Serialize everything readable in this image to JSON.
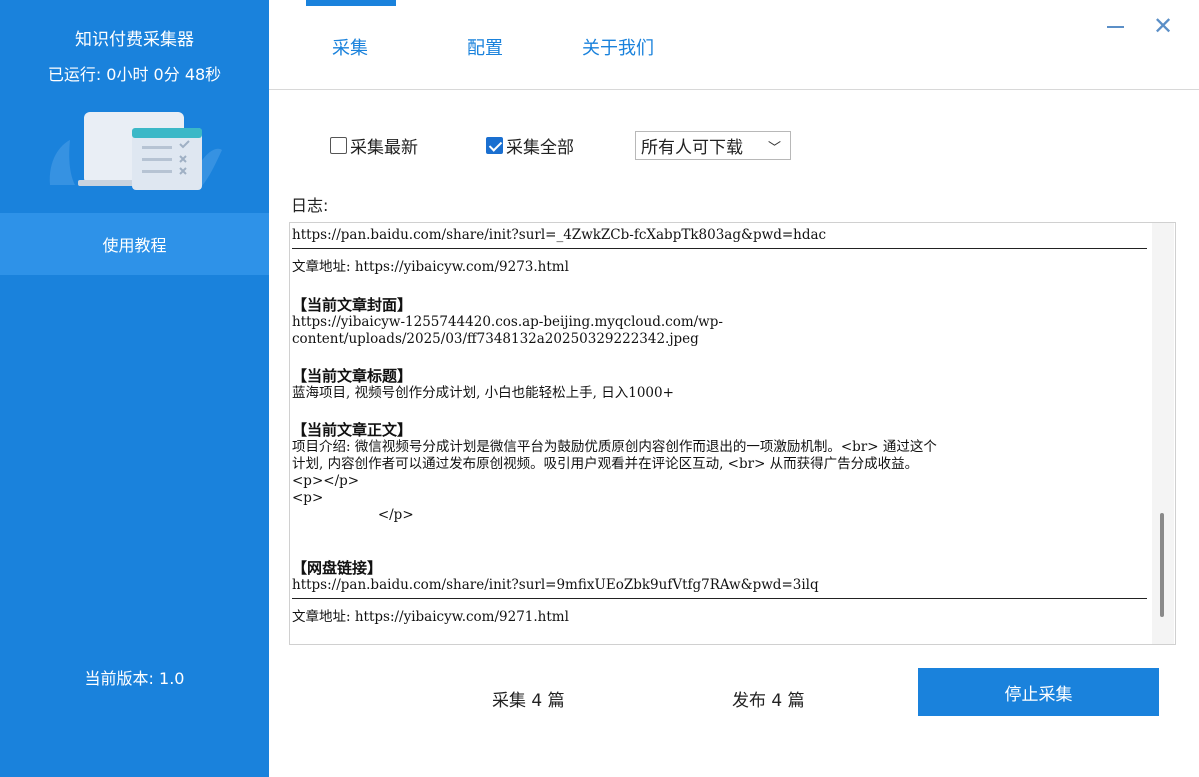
{
  "sidebar": {
    "app_title": "知识付费采集器",
    "runtime": "已运行: 0小时 0分 48秒",
    "tutorial_label": "使用教程",
    "version": "当前版本: 1.0"
  },
  "tabs": {
    "collect": "采集",
    "config": "配置",
    "about": "关于我们"
  },
  "window": {
    "minimize_glyph": "—",
    "close_glyph": "✕"
  },
  "options": {
    "latest_label": "采集最新",
    "latest_checked": false,
    "all_label": "采集全部",
    "all_checked": true,
    "permission_select": "所有人可下载"
  },
  "log": {
    "label": "日志:",
    "lines": {
      "l1": "https://pan.baidu.com/share/init?surl=_4ZwkZCb-fcXabpTk803ag&pwd=hdac",
      "l2": "文章地址: https://yibaicyw.com/9273.html",
      "h_cover": "【当前文章封面】",
      "l3": "https://yibaicyw-1255744420.cos.ap-beijing.myqcloud.com/wp-",
      "l4": "content/uploads/2025/03/ff7348132a20250329222342.jpeg",
      "h_title": "【当前文章标题】",
      "l5": "蓝海项目, 视频号创作分成计划, 小白也能轻松上手, 日入1000+",
      "h_body": "【当前文章正文】",
      "l6": "项目介绍: 微信视频号分成计划是微信平台为鼓励优质原创内容创作而退出的一项激励机制。<br> 通过这个",
      "l7": "计划, 内容创作者可以通过发布原创视频。吸引用户观看并在评论区互动, <br> 从而获得广告分成收益。",
      "l8": "<p></p>",
      "l9": "<p>",
      "l10": "                    </p>",
      "h_disk": "【网盘链接】",
      "l11": "https://pan.baidu.com/share/init?surl=9mfixUEoZbk9ufVtfg7RAw&pwd=3ilq",
      "l12": "文章地址: https://yibaicyw.com/9271.html"
    }
  },
  "footer": {
    "collect_count": "采集 4 篇",
    "publish_count": "发布 4 篇",
    "stop_button": "停止采集"
  },
  "colors": {
    "primary": "#1a82dc",
    "sidebar_highlight": "#2e92e8"
  }
}
